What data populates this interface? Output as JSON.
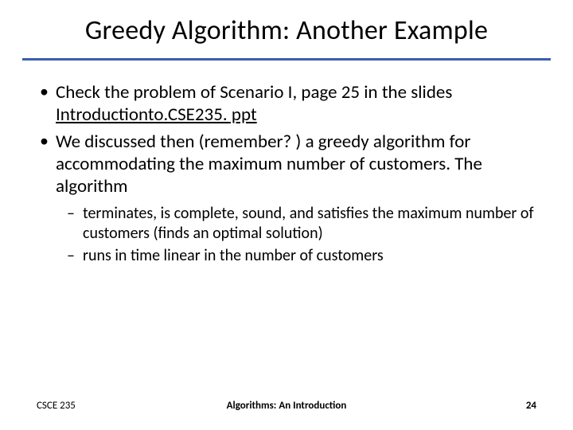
{
  "title": "Greedy Algorithm: Another Example",
  "bullets": {
    "b1_pre": "Check the problem of Scenario I, page 25 in the slides ",
    "b1_link": "Introductionto.CSE235. ppt",
    "b2": "We discussed then (remember? ) a greedy algorithm for accommodating the maximum number of customers. The algorithm",
    "sub1": "terminates, is complete, sound, and satisfies the maximum number of customers (finds an optimal solution)",
    "sub2": "runs in time linear in the number of customers"
  },
  "footer": {
    "left": "CSCE 235",
    "center": "Algorithms: An Introduction",
    "right": "24"
  }
}
